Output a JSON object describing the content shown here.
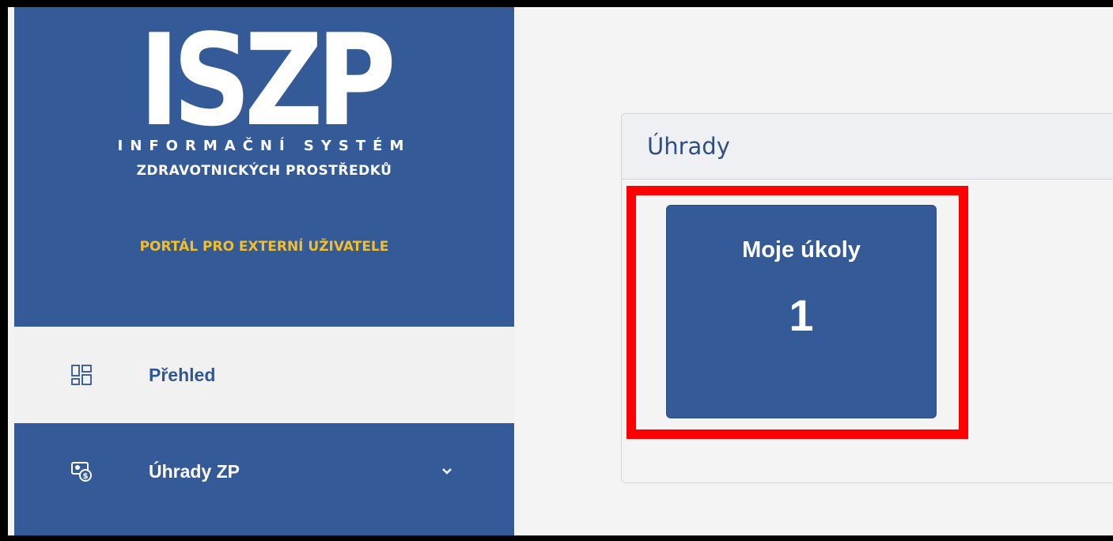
{
  "branding": {
    "logo_text": "ISZP",
    "subtitle_line1": "INFORMAČNÍ SYSTÉM",
    "subtitle_line2": "ZDRAVOTNICKÝCH PROSTŘEDKŮ",
    "portal_label": "PORTÁL PRO EXTERNÍ UŽIVATELE"
  },
  "sidebar": {
    "items": [
      {
        "label": "Přehled",
        "icon": "dashboard-icon",
        "active": true
      },
      {
        "label": "Úhrady ZP",
        "icon": "payment-icon",
        "active": false,
        "has_submenu": true
      }
    ]
  },
  "main": {
    "panel": {
      "title": "Úhrady",
      "tiles": [
        {
          "label": "Moje úkoly",
          "count": "1"
        }
      ]
    }
  },
  "colors": {
    "sidebar_bg": "#345b98",
    "accent_yellow": "#f2bf2c",
    "tile_bg": "#345b98",
    "highlight": "#ff0000",
    "active_nav_text": "#2f5697"
  }
}
